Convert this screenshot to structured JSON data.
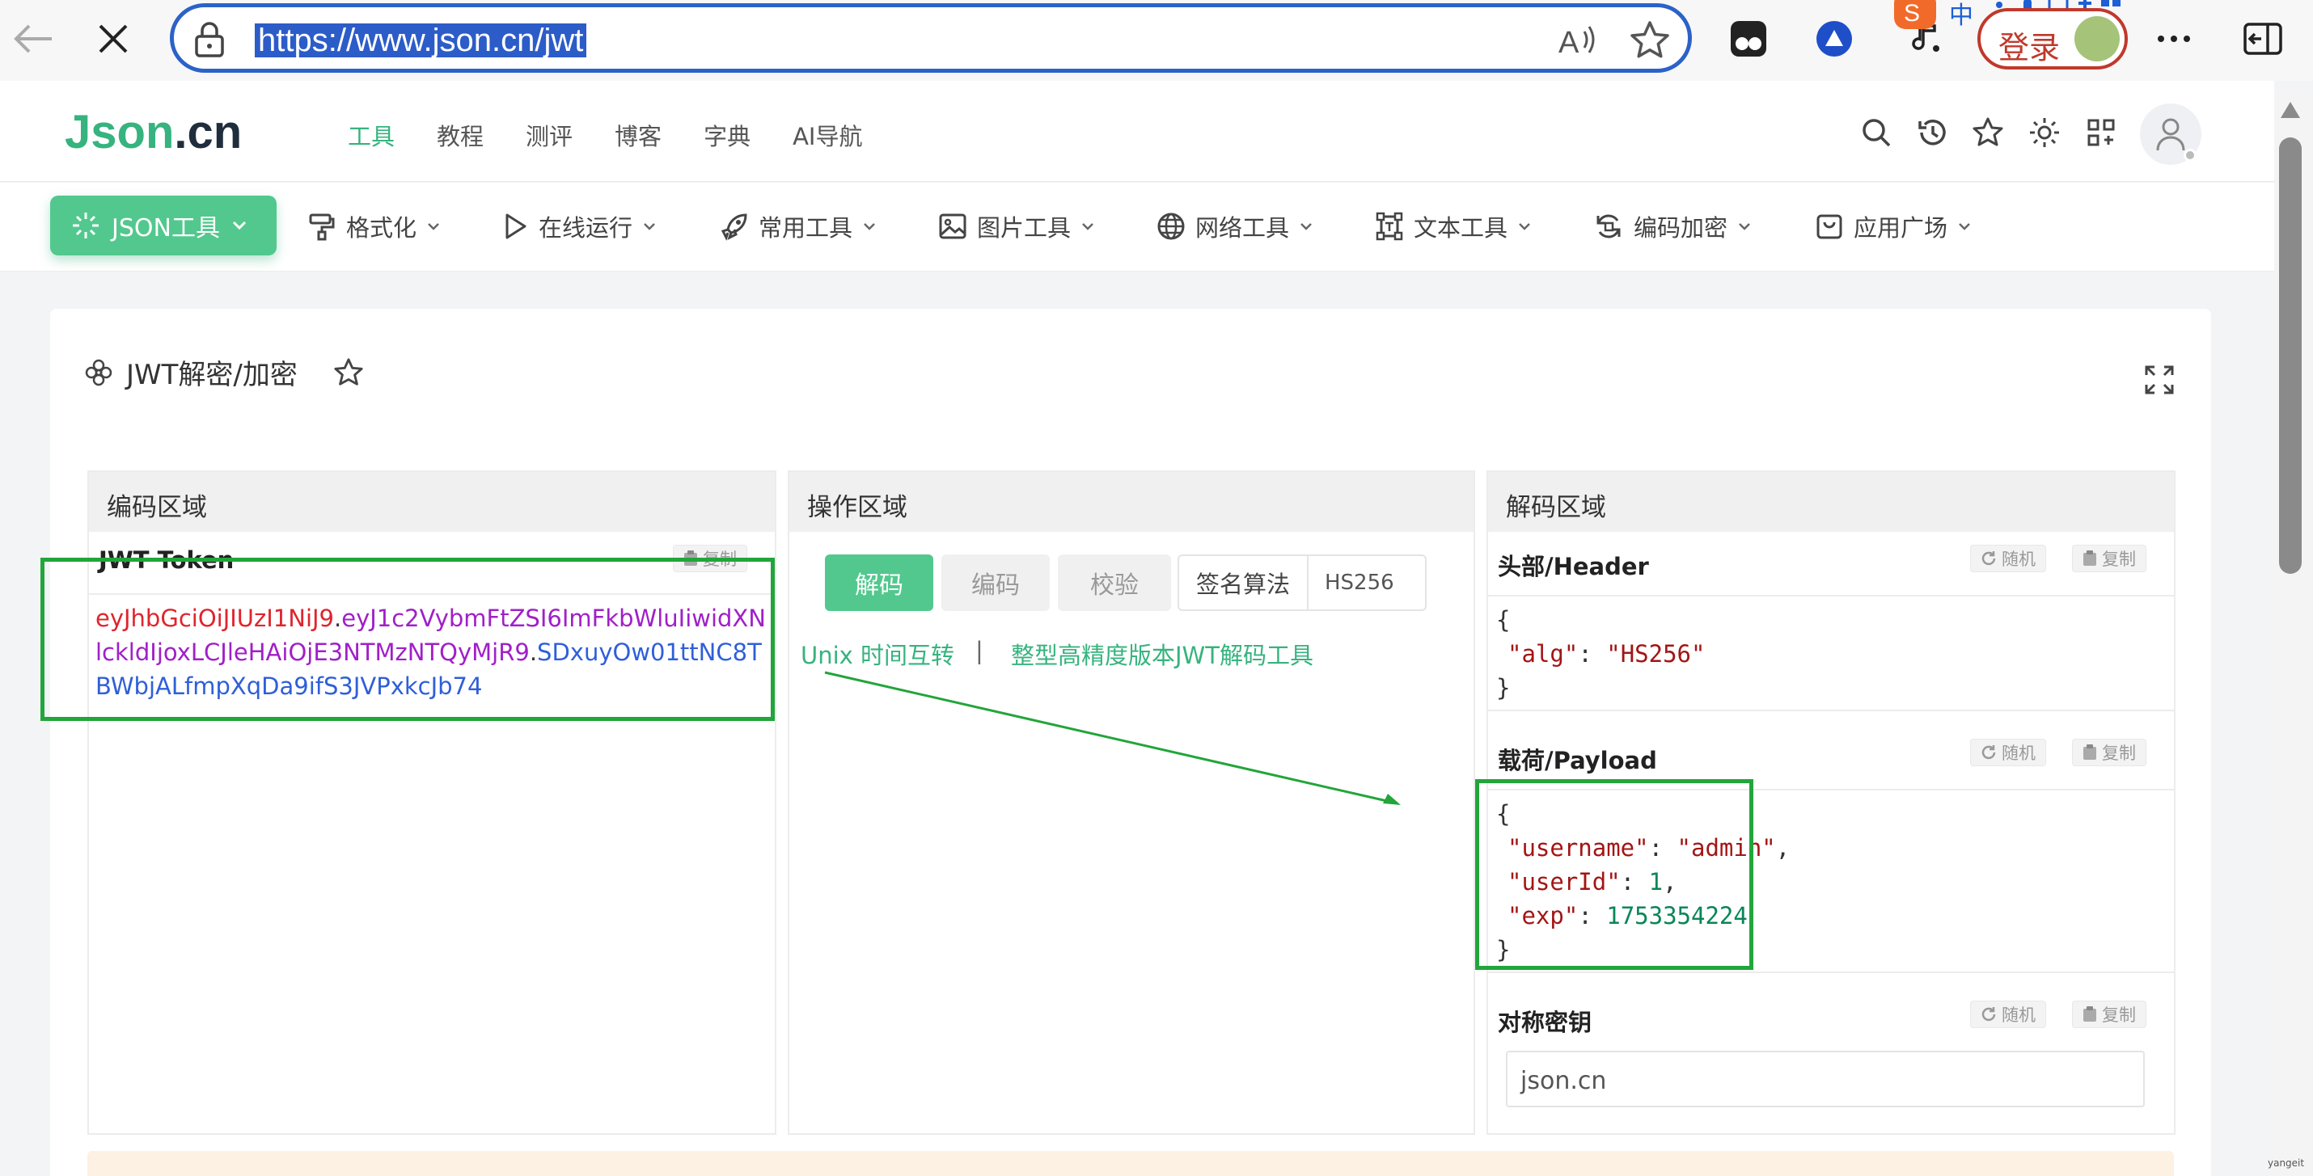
{
  "browser": {
    "url": "https://www.json.cn/jwt",
    "login_label": "登录",
    "ime_label": "中"
  },
  "site": {
    "logo": {
      "part1": "Json",
      "part2": ".cn"
    },
    "top_nav": [
      "工具",
      "教程",
      "测评",
      "博客",
      "字典",
      "AI导航"
    ],
    "active_nav": "工具",
    "tools_menu": [
      {
        "label": "JSON工具",
        "icon": "sparkle-icon"
      },
      {
        "label": "格式化",
        "icon": "paint-roller-icon"
      },
      {
        "label": "在线运行",
        "icon": "play-icon"
      },
      {
        "label": "常用工具",
        "icon": "rocket-icon"
      },
      {
        "label": "图片工具",
        "icon": "image-icon"
      },
      {
        "label": "网络工具",
        "icon": "globe-icon"
      },
      {
        "label": "文本工具",
        "icon": "text-frame-icon"
      },
      {
        "label": "编码加密",
        "icon": "refresh-code-icon"
      },
      {
        "label": "应用广场",
        "icon": "app-box-icon"
      }
    ]
  },
  "page": {
    "title": "JWT解密/加密"
  },
  "encode_panel": {
    "header": "编码区域",
    "label": "JWT Token",
    "copy_label": "复制",
    "token_header": "eyJhbGciOiJIUzI1NiJ9",
    "dot": ".",
    "token_payload": "eyJ1c2VybmFtZSI6ImFkbWluIiwidXNlckldIjoxLCJleHAiOjE3NTMzNTQyMjR9",
    "token_signature": "SDxuyOw01ttNC8TBWbjALfmpXqDa9ifS3JVPxkcJb74"
  },
  "op_panel": {
    "header": "操作区域",
    "decode": "解码",
    "encode": "编码",
    "verify": "校验",
    "alg_label": "签名算法",
    "alg_value": "HS256",
    "link1": "Unix 时间互转",
    "separator": "|",
    "link2": "整型高精度版本JWT解码工具"
  },
  "decode_panel": {
    "header": "解码区域",
    "random_label": "随机",
    "copy_label": "复制",
    "header_label": "头部/Header",
    "header_json": {
      "open": "{",
      "key": "\"alg\"",
      "colon": ": ",
      "value": "\"HS256\"",
      "close": "}"
    },
    "payload_label": "载荷/Payload",
    "payload_json": {
      "open": "{",
      "k1": "\"username\"",
      "v1": "\"admin\"",
      "k2": "\"userId\"",
      "v2": "1",
      "k3": "\"exp\"",
      "v3": "1753354224",
      "close": "}"
    },
    "secret_label": "对称密钥",
    "secret_value": "json.cn"
  },
  "watermark": "yangeit",
  "colors": {
    "accent": "#36b37e",
    "annotation": "#22a53a",
    "token_header": "#e0242d",
    "token_payload": "#a020c8",
    "token_signature": "#2f5fd8"
  }
}
